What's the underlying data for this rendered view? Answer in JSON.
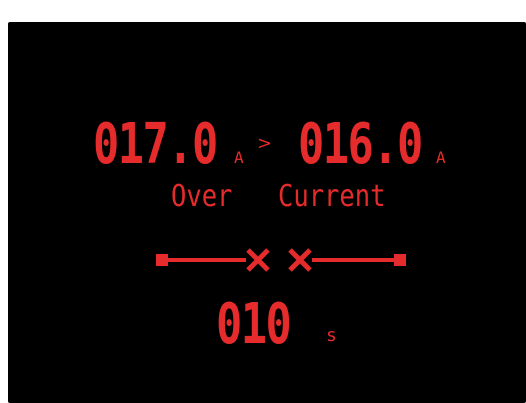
{
  "display": {
    "measured_value": "017.0",
    "measured_unit": "A",
    "comparator": ">",
    "threshold_value": "016.0",
    "threshold_unit": "A",
    "fault_word_1": "Over",
    "fault_word_2": "Current",
    "time_value": "010",
    "time_unit": "s",
    "colors": {
      "background": "#000000",
      "text": "#e52b2b"
    }
  }
}
